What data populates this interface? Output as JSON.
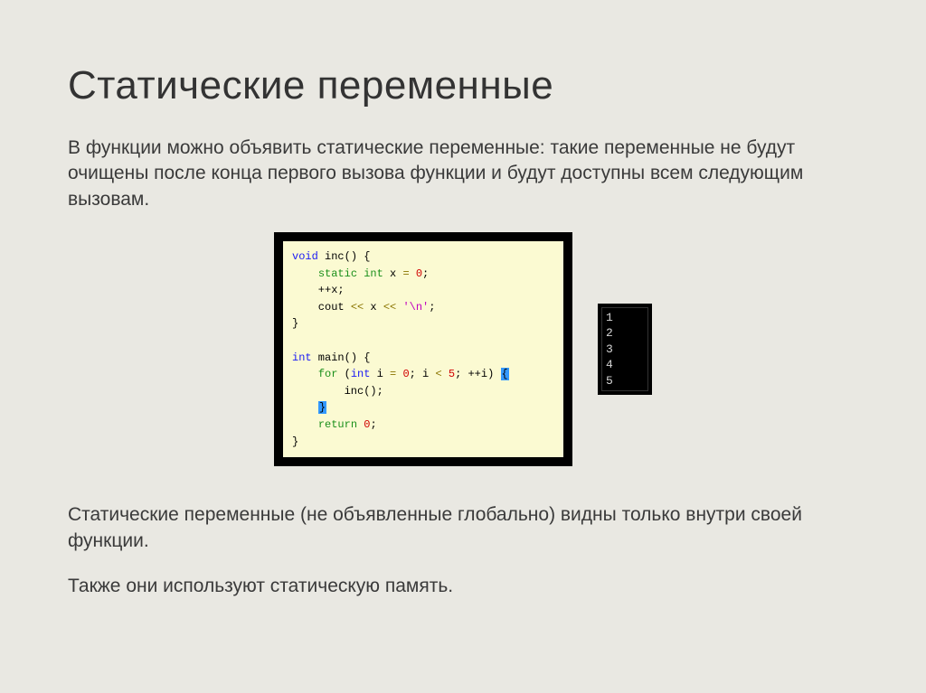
{
  "title": "Статические переменные",
  "para1": "В функции можно объявить статические переменные: такие переменные не будут очищены после конца первого вызова функции и будут доступны всем следующим вызовам.",
  "para2": "Статические переменные (не объявленные глобально) видны только внутри своей функции.",
  "para3": "Также они используют статическую память.",
  "code": {
    "l1_kw1": "void",
    "l1_rest": " inc() {",
    "l2_kw": "static int",
    "l2_mid": " x ",
    "l2_eq": "=",
    "l2_sp": " ",
    "l2_num": "0",
    "l2_end": ";",
    "l3": "    ++x;",
    "l4_a": "    cout ",
    "l4_op1": "<<",
    "l4_b": " x ",
    "l4_op2": "<<",
    "l4_c": " ",
    "l4_str": "'\\n'",
    "l4_end": ";",
    "l5": "}",
    "blank": "",
    "l6_kw": "int",
    "l6_rest": " main() {",
    "l7_a": "    ",
    "l7_for": "for",
    "l7_b": " (",
    "l7_int": "int",
    "l7_c": " i ",
    "l7_eq": "=",
    "l7_d": " ",
    "l7_n0": "0",
    "l7_e": "; i ",
    "l7_lt": "<",
    "l7_f": " ",
    "l7_n5": "5",
    "l7_g": "; ++i) ",
    "l7_brace": "{",
    "l8": "        inc();",
    "l9_pre": "    ",
    "l9_brace": "}",
    "l10_a": "    ",
    "l10_kw": "return",
    "l10_b": " ",
    "l10_num": "0",
    "l10_end": ";",
    "l11": "}"
  },
  "output": "1\n2\n3\n4\n5"
}
